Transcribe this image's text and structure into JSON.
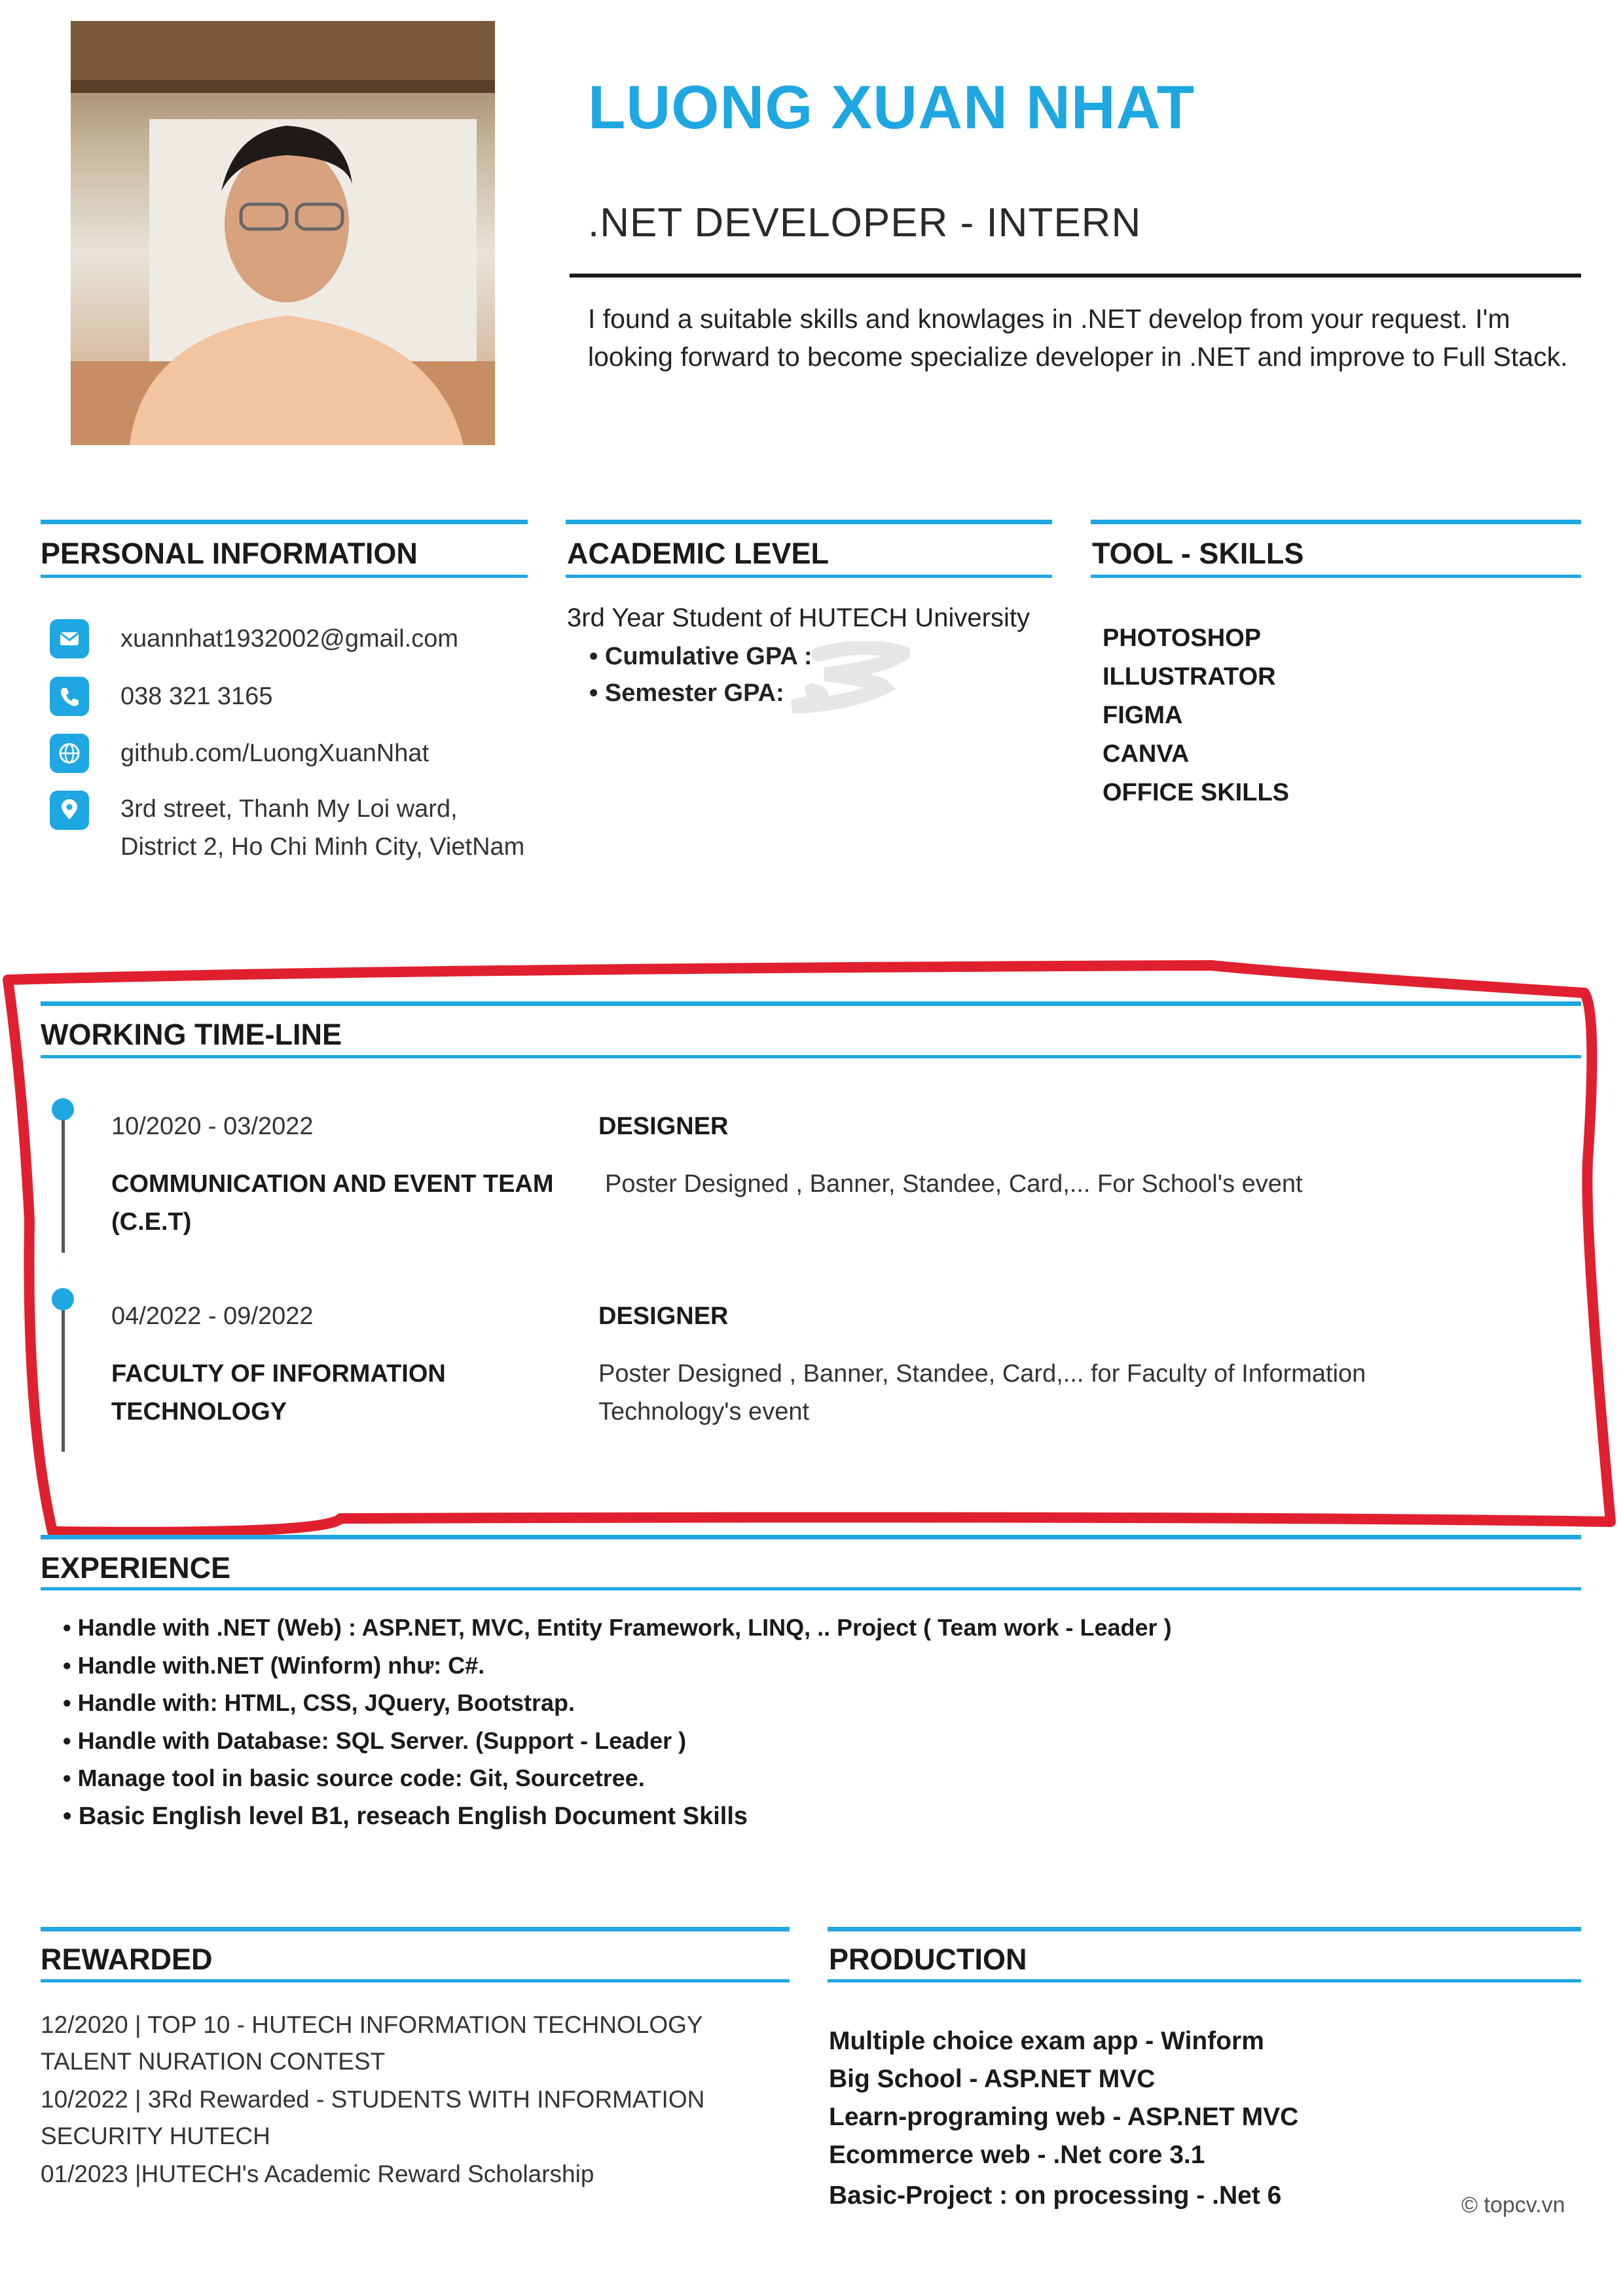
{
  "header": {
    "name": "LUONG XUAN NHAT",
    "job_title": ".NET DEVELOPER - INTERN",
    "summary": "I found a suitable skills and knowlages in .NET develop from your request. I'm looking forward to become specialize developer in  .NET and improve to Full Stack."
  },
  "personal": {
    "title": "PERSONAL INFORMATION",
    "email": "xuannhat1932002@gmail.com",
    "phone": "038 321 3165",
    "github": "github.com/LuongXuanNhat",
    "address": "3rd street, Thanh My Loi ward, District 2, Ho Chi Minh City, VietNam"
  },
  "academic": {
    "title": "ACADEMIC LEVEL",
    "main": "3rd Year Student of HUTECH University",
    "bullets": [
      "Cumulative GPA :",
      "Semester GPA:"
    ]
  },
  "tools": {
    "title": "TOOL - SKILLS",
    "items": [
      "PHOTOSHOP",
      "ILLUSTRATOR",
      "FIGMA",
      "CANVA",
      "OFFICE SKILLS"
    ]
  },
  "timeline": {
    "title": "WORKING TIME-LINE",
    "entries": [
      {
        "start": "10/2020",
        "end": "03/2022",
        "org": "COMMUNICATION AND EVENT TEAM (C.E.T)",
        "role": "DESIGNER",
        "desc": "Poster Designed , Banner, Standee, Card,... For School's event"
      },
      {
        "start": "04/2022",
        "end": "09/2022",
        "org": "FACULTY OF INFORMATION TECHNOLOGY",
        "role": "DESIGNER",
        "desc": "Poster Designed , Banner, Standee, Card,... for Faculty of Information Technology's event"
      }
    ]
  },
  "experience": {
    "title": "EXPERIENCE",
    "items": [
      "Handle with .NET (Web) : ASP.NET, MVC, Entity Framework, LINQ, .. Project ( Team work - Leader )",
      "Handle with.NET (Winform) như: C#.",
      "Handle with:  HTML, CSS, JQuery, Bootstrap.",
      "Handle with Database: SQL Server. (Support - Leader )",
      "Manage tool in basic source code: Git, Sourcetree.",
      "Basic English level B1, reseach English Document Skills"
    ]
  },
  "rewarded": {
    "title": "REWARDED",
    "items": [
      "12/2020 | TOP 10 - HUTECH INFORMATION TECHNOLOGY TALENT NURATION CONTEST",
      "10/2022 | 3Rd Rewarded - STUDENTS WITH INFORMATION SECURITY HUTECH",
      "01/2023 |HUTECH's Academic Reward Scholarship"
    ]
  },
  "production": {
    "title": "PRODUCTION",
    "items": [
      "Multiple choice exam app - Winform",
      "Big School - ASP.NET MVC",
      "Learn-programing web - ASP.NET MVC",
      "Ecommerce web -  .Net core 3.1",
      "Basic-Project : on processing - .Net 6"
    ]
  },
  "footer": {
    "copyright": "© topcv.vn"
  },
  "colors": {
    "accent": "#1ea7e1",
    "marker": "#e0202e"
  },
  "icons": [
    "envelope-icon",
    "phone-icon",
    "globe-icon",
    "location-pin-icon"
  ]
}
